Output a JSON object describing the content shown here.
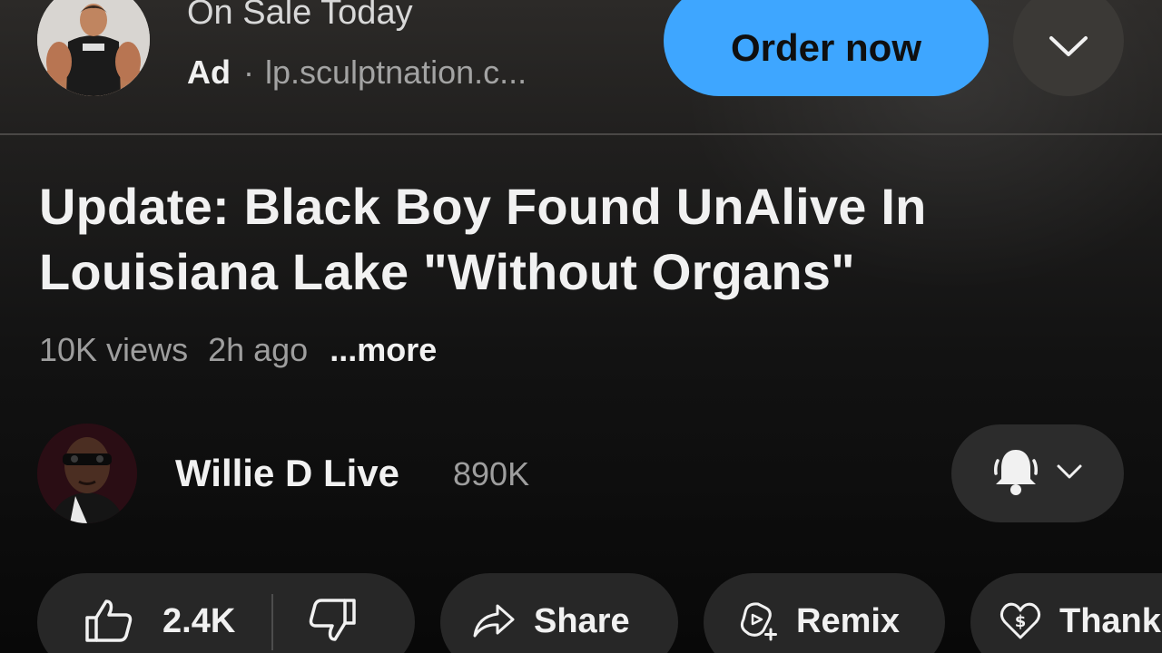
{
  "ad": {
    "title": "On Sale Today",
    "label": "Ad",
    "separator": "·",
    "url": "lp.sculptnation.c...",
    "cta": "Order now",
    "expand_icon": "chevron-down-icon",
    "cta_color": "#3ea6ff"
  },
  "video": {
    "title": "Update: Black Boy Found UnAlive In Louisiana Lake \"Without Organs\"",
    "views": "10K views",
    "age": "2h ago",
    "more": "...more"
  },
  "channel": {
    "name": "Willie D Live",
    "subscribers": "890K",
    "bell_icon": "bell-icon",
    "chevron_icon": "chevron-down-icon"
  },
  "actions": {
    "likes": "2.4K",
    "like_icon": "thumbs-up-icon",
    "dislike_icon": "thumbs-down-icon",
    "share": "Share",
    "share_icon": "share-arrow-icon",
    "remix": "Remix",
    "remix_icon": "remix-icon",
    "thanks": "Thanks",
    "thanks_icon": "heart-dollar-icon"
  },
  "theme": {
    "background": "#0f0f0f",
    "chip_background": "#272727",
    "text_primary": "#f1f1f1",
    "text_secondary": "#9e9e9e"
  }
}
